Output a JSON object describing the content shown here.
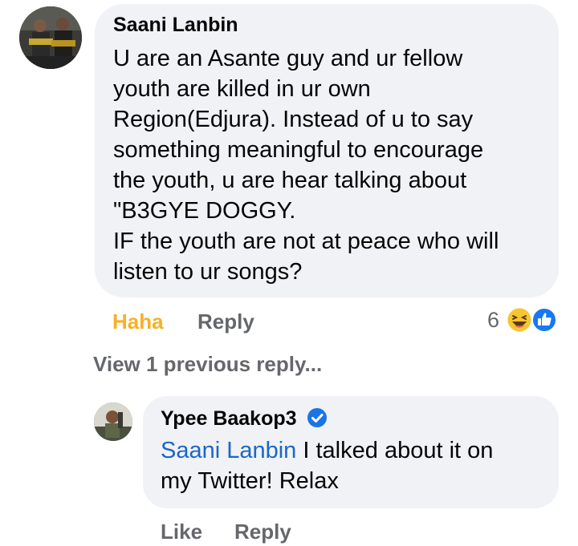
{
  "comment": {
    "author": "Saani Lanbin",
    "lines": [
      "U are an Asante guy and ur fellow",
      "youth are killed in ur own",
      "Region(Edjura). Instead of u to  say",
      "something meaningful to encourage",
      "the youth, u are hear talking about",
      "\"B3GYE DOGGY.",
      "IF the youth are not at peace who will",
      "listen to ur songs?"
    ],
    "reaction_label": "Haha",
    "reply_label": "Reply",
    "reaction_count": "6",
    "reaction_icons": [
      "haha-emoji-icon",
      "like-icon"
    ],
    "view_replies": "View 1 previous reply..."
  },
  "reply": {
    "author": "Ypee Baakop3",
    "verified_icon": "verified-badge-icon",
    "mention": "Saani Lanbin",
    "text_after_mention": " I talked about it on",
    "line2": "my Twitter! Relax",
    "like_label": "Like",
    "reply_label": "Reply"
  },
  "colors": {
    "bubble": "#f0f2f5",
    "haha_active": "#f7b125",
    "mention": "#1b66c9",
    "action_gray": "#65676b",
    "like_blue": "#1877f2",
    "verified_blue": "#1b74e4"
  }
}
